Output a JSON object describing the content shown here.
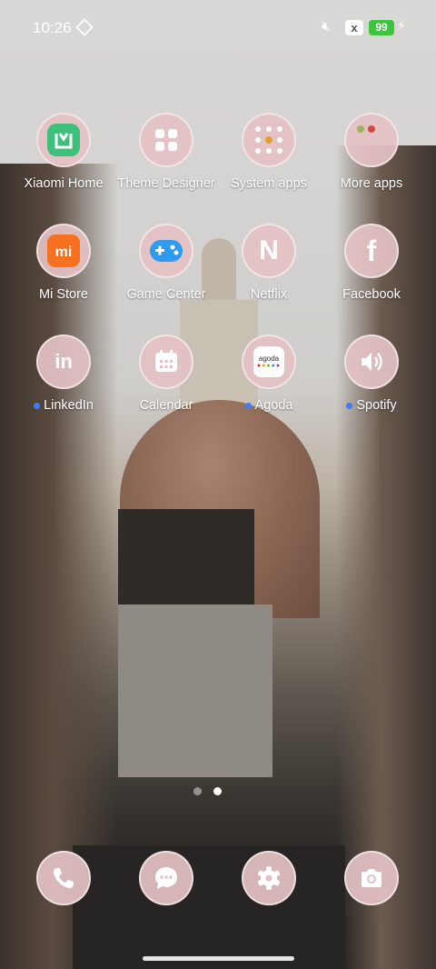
{
  "status_bar": {
    "time": "10:26",
    "battery": "99",
    "x_badge": "x"
  },
  "apps": [
    {
      "label": "Xiaomi Home",
      "icon": "xiaomi-home-icon",
      "dot": false
    },
    {
      "label": "Theme Designer",
      "icon": "grid-icon",
      "dot": false
    },
    {
      "label": "System apps",
      "icon": "folder-icon",
      "dot": false
    },
    {
      "label": "More apps",
      "icon": "folder-icon",
      "dot": false
    },
    {
      "label": "Mi Store",
      "icon": "mi-icon",
      "dot": false
    },
    {
      "label": "Game Center",
      "icon": "gamepad-icon",
      "dot": false
    },
    {
      "label": "Netflix",
      "icon": "netflix-icon",
      "dot": false
    },
    {
      "label": "Facebook",
      "icon": "facebook-icon",
      "dot": false
    },
    {
      "label": "LinkedIn",
      "icon": "linkedin-icon",
      "dot": true
    },
    {
      "label": "Calendar",
      "icon": "calendar-icon",
      "dot": false
    },
    {
      "label": "Agoda",
      "icon": "agoda-icon",
      "dot": true
    },
    {
      "label": "Spotify",
      "icon": "speaker-icon",
      "dot": true
    }
  ],
  "icon_glyphs": {
    "mi": "mi",
    "netflix": "N",
    "facebook": "f",
    "linkedin": "in",
    "agoda": "agoda"
  },
  "dock": [
    {
      "name": "phone",
      "icon": "phone-icon"
    },
    {
      "name": "messages",
      "icon": "chat-icon"
    },
    {
      "name": "settings",
      "icon": "gear-icon"
    },
    {
      "name": "camera",
      "icon": "camera-icon"
    }
  ],
  "colors": {
    "icon_bg": "#e4c1c3",
    "notification_dot": "#3d7bff",
    "battery": "#3cc43c",
    "mi_orange": "#f5701f",
    "xiaomi_home_green": "#3ec07a",
    "game_blue": "#2f9bf0"
  },
  "page_indicator": {
    "pages": 2,
    "current": 2
  }
}
